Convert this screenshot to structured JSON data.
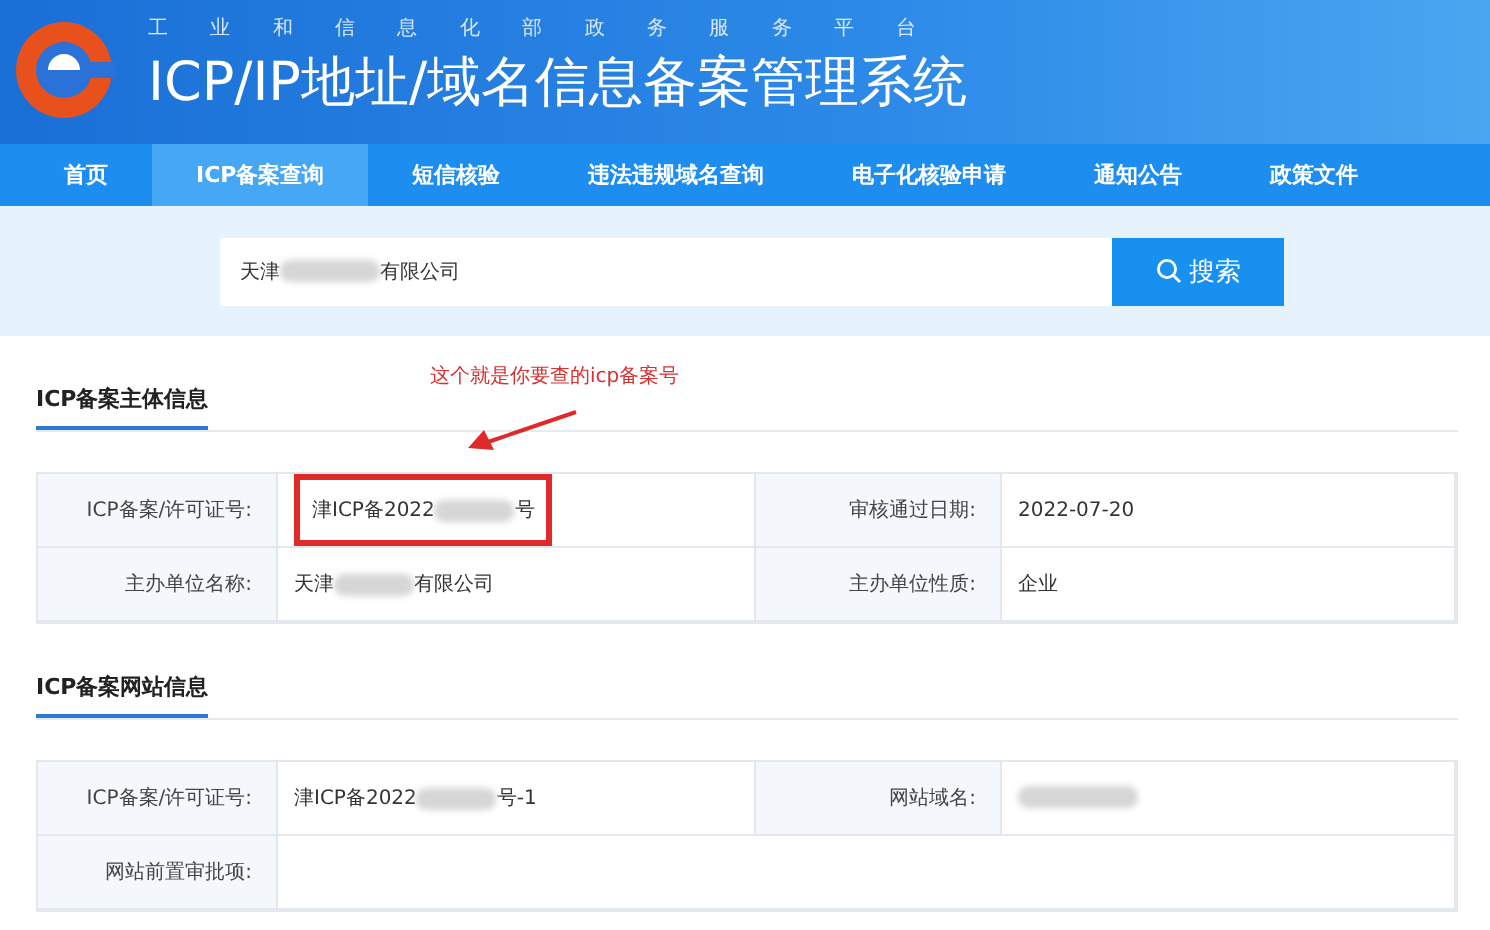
{
  "header": {
    "subtitle": "工 业 和 信 息 化 部 政 务 服 务 平 台",
    "title": "ICP/IP地址/域名信息备案管理系统"
  },
  "nav": [
    {
      "label": "首页",
      "selected": false
    },
    {
      "label": "ICP备案查询",
      "selected": true
    },
    {
      "label": "短信核验",
      "selected": false
    },
    {
      "label": "违法违规域名查询",
      "selected": false
    },
    {
      "label": "电子化核验申请",
      "selected": false
    },
    {
      "label": "通知公告",
      "selected": false
    },
    {
      "label": "政策文件",
      "selected": false
    }
  ],
  "search": {
    "value_start": "天津",
    "redacted": true,
    "value_end": "有限公司",
    "button": "搜索"
  },
  "annotation": {
    "text": "这个就是你要查的icp备案号"
  },
  "sections": [
    {
      "title": "ICP备案主体信息",
      "rows": [
        [
          {
            "label": "ICP备案/许可证号:",
            "value_start": "津ICP备2022",
            "redacted": true,
            "value_end": "号",
            "highlighted": true
          },
          {
            "label": "审核通过日期:",
            "value_start": "2022-07-20",
            "redacted": false,
            "highlighted": false
          }
        ],
        [
          {
            "label": "主办单位名称:",
            "value_start": "天津",
            "redacted": true,
            "value_end": "有限公司",
            "highlighted": false
          },
          {
            "label": "主办单位性质:",
            "value_start": "企业",
            "redacted": false,
            "highlighted": false
          }
        ]
      ]
    },
    {
      "title": "ICP备案网站信息",
      "rows": [
        [
          {
            "label": "ICP备案/许可证号:",
            "value_start": "津ICP备2022",
            "redacted": true,
            "value_end": "号-1",
            "highlighted": false
          },
          {
            "label": "网站域名:",
            "redacted": true,
            "highlighted": false
          }
        ],
        [
          {
            "label": "网站前置审批项:"
          }
        ]
      ]
    }
  ]
}
